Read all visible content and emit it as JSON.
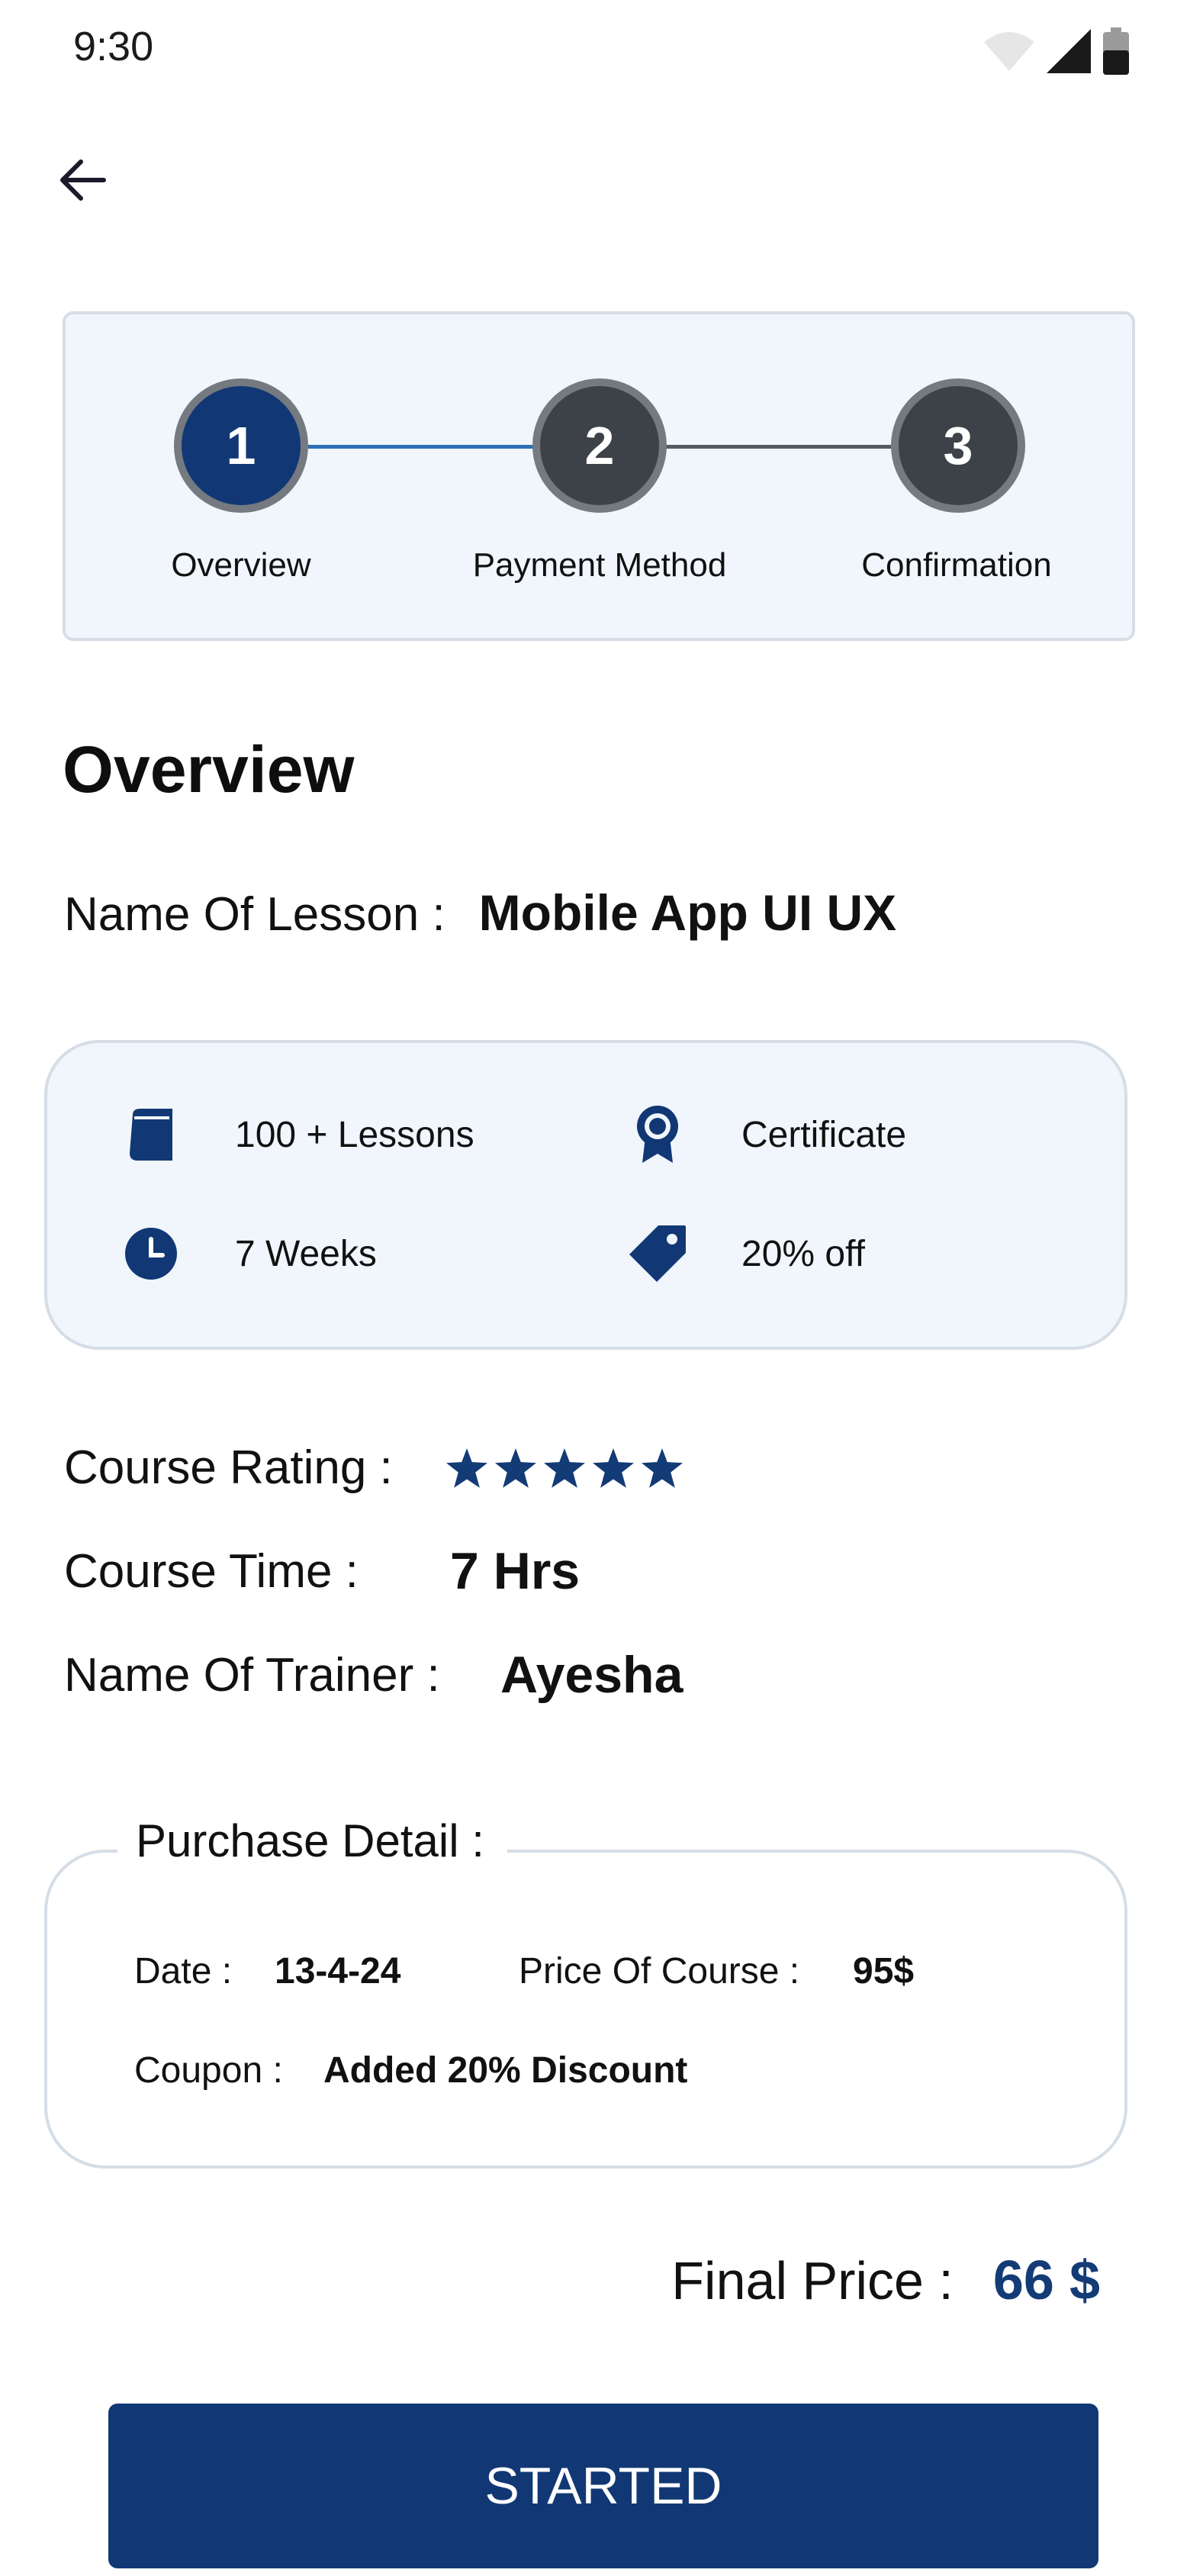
{
  "status_bar": {
    "time": "9:30",
    "icons": [
      "wifi-icon",
      "signal-icon",
      "battery-icon"
    ]
  },
  "header": {
    "back_icon": "arrow-left-icon"
  },
  "stepper": {
    "steps": [
      {
        "number": "1",
        "label": "Overview",
        "state": "active"
      },
      {
        "number": "2",
        "label": "Payment Method",
        "state": "inactive"
      },
      {
        "number": "3",
        "label": "Confirmation",
        "state": "inactive"
      }
    ]
  },
  "overview": {
    "title": "Overview",
    "lesson_label": "Name Of Lesson :",
    "lesson_value": "Mobile App UI UX"
  },
  "info_card": {
    "items": [
      {
        "icon": "book-icon",
        "text": "100 + Lessons"
      },
      {
        "icon": "certificate-icon",
        "text": "Certificate"
      },
      {
        "icon": "clock-icon",
        "text": "7 Weeks"
      },
      {
        "icon": "tag-icon",
        "text": "20% off"
      }
    ]
  },
  "details": {
    "rating_label": "Course Rating :",
    "rating_stars": 5,
    "time_label": "Course Time :",
    "time_value": "7 Hrs",
    "trainer_label": "Name Of Trainer :",
    "trainer_value": "Ayesha"
  },
  "purchase": {
    "title": "Purchase Detail :",
    "date_label": "Date :",
    "date_value": "13-4-24",
    "price_label": "Price Of Course :",
    "price_value": "95$",
    "coupon_label": "Coupon :",
    "coupon_value": "Added 20% Discount"
  },
  "final": {
    "label": "Final Price :",
    "value": "66 $"
  },
  "button": {
    "label": "STARTED"
  },
  "colors": {
    "primary": "#113874",
    "card_bg": "#f0f6fc",
    "border": "#d5dde6",
    "step_inactive": "#3d4249",
    "line_active": "#2f6fb6"
  }
}
